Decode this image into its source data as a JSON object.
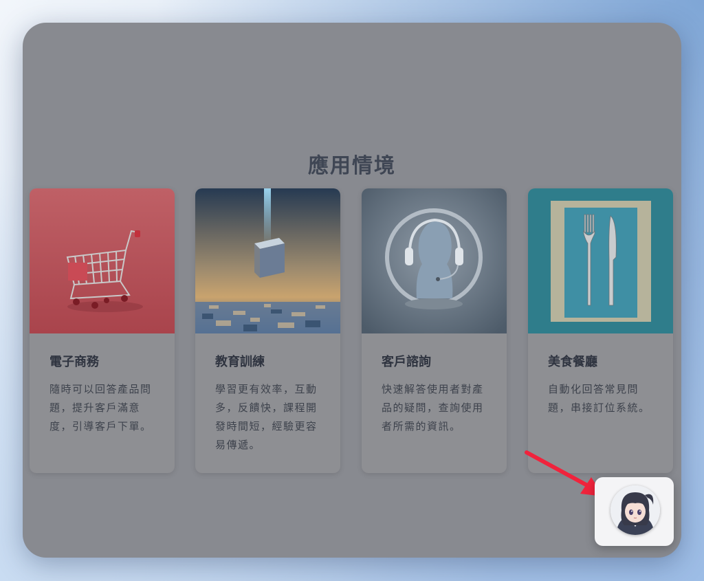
{
  "section": {
    "title": "應用情境"
  },
  "cards": [
    {
      "title": "電子商務",
      "description": "隨時可以回答產品問題，提升客戶滿意度，引導客戶下單。",
      "image": "shopping-cart-image"
    },
    {
      "title": "教育訓練",
      "description": "學習更有效率，互動多，反饋快，課程開發時間短，經驗更容易傳遞。",
      "image": "glowing-book-image"
    },
    {
      "title": "客戶諮詢",
      "description": "快速解答使用者對產品的疑問，查詢使用者所需的資訊。",
      "image": "headset-head-image"
    },
    {
      "title": "美食餐廳",
      "description": "自動化回答常見問題，串接訂位系統。",
      "image": "fork-knife-image"
    }
  ],
  "chat_widget": {
    "icon": "anime-girl-avatar",
    "annotation": "red-arrow-pointer"
  },
  "colors": {
    "overlay": "#888a90",
    "card": "#8e8f93",
    "arrow": "#f0233c"
  }
}
